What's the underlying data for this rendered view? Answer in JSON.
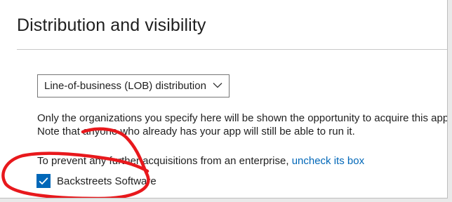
{
  "section": {
    "title": "Distribution and visibility"
  },
  "distribution": {
    "selected": "Line-of-business (LOB) distribution"
  },
  "info": {
    "line1": "Only the organizations you specify here will be shown the opportunity to acquire this app.",
    "line2": "Note that anyone who already has your app will still be able to run it."
  },
  "prevent": {
    "text": "To prevent any further acquisitions from an enterprise, ",
    "link": "uncheck its box"
  },
  "enterprises": [
    {
      "label": "Backstreets Software",
      "checked": true
    }
  ],
  "colors": {
    "accent": "#0067b8",
    "annotation": "#e8181c"
  },
  "icons": {
    "dropdown": "chevron-down-icon",
    "check": "checkmark-icon"
  }
}
